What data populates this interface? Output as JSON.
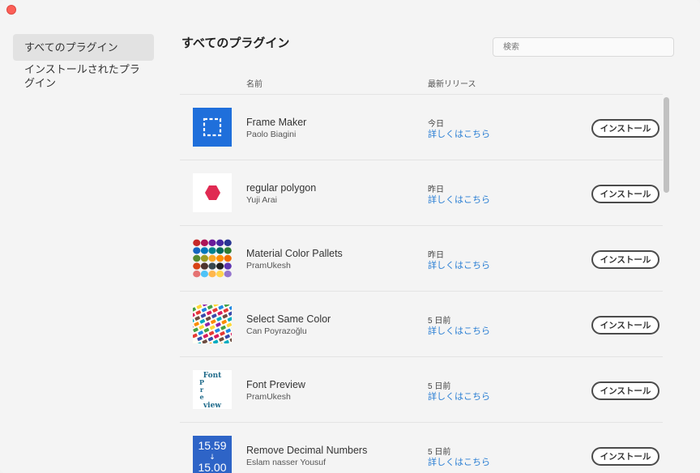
{
  "sidebar": {
    "items": [
      {
        "label": "すべてのプラグイン",
        "active": true
      },
      {
        "label": "インストールされたプラグイン",
        "active": false
      }
    ]
  },
  "main": {
    "title": "すべてのプラグイン",
    "search_placeholder": "検索",
    "col_name": "名前",
    "col_release": "最新リリース",
    "link_label": "詳しくはこちら",
    "install_label": "インストール"
  },
  "plugins": [
    {
      "name": "Frame Maker",
      "author": "Paolo Biagini",
      "release": "今日",
      "icon": "frame-maker-icon"
    },
    {
      "name": "regular polygon",
      "author": "Yuji Arai",
      "release": "昨日",
      "icon": "hexagon-icon"
    },
    {
      "name": "Material Color Pallets",
      "author": "PramUkesh",
      "release": "昨日",
      "icon": "color-pallets-icon"
    },
    {
      "name": "Select Same Color",
      "author": "Can Poyrazoğlu",
      "release": "5 日前",
      "icon": "select-same-color-icon"
    },
    {
      "name": "Font Preview",
      "author": "PramUkesh",
      "release": "5 日前",
      "icon": "font-preview-icon",
      "icon_text": [
        "Font",
        "P",
        "r",
        "e",
        "view"
      ]
    },
    {
      "name": "Remove Decimal Numbers",
      "author": "Eslam nasser Yousuf",
      "release": "5 日前",
      "icon": "remove-decimal-icon",
      "icon_text": [
        "15.59",
        "↓",
        "15.00"
      ]
    }
  ],
  "colors": {
    "accent_link": "#2a7ed3",
    "frame_maker_bg": "#1f6fdb",
    "hexagon": "#e02a52",
    "close_button": "#fc5f57"
  }
}
